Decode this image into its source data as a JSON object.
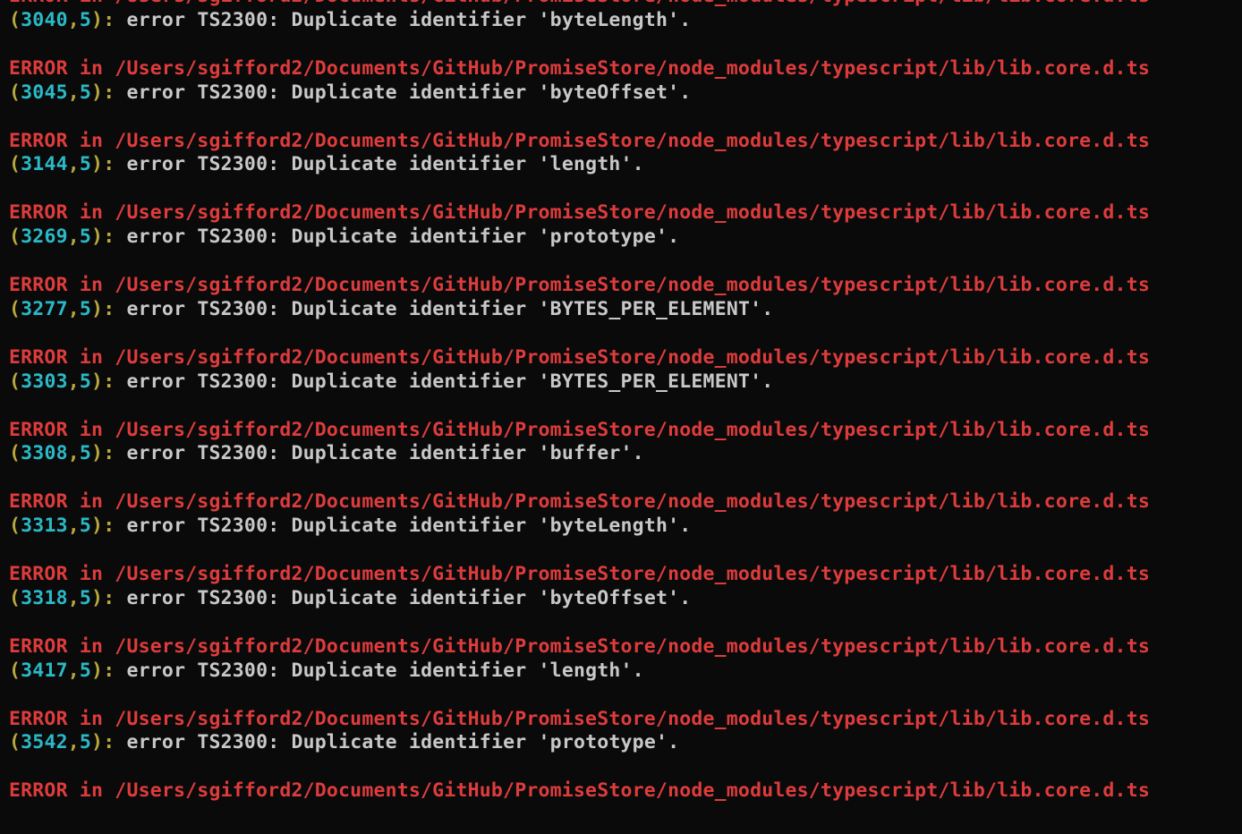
{
  "filepath": "/Users/sgifford2/Documents/GitHub/PromiseStore/node_modules/typescript/lib/lib.core.d.ts",
  "errorPrefix": "ERROR in ",
  "errors": [
    {
      "line": "3040",
      "col": "5",
      "code": "TS2300",
      "identifier": "byteLength"
    },
    {
      "line": "3045",
      "col": "5",
      "code": "TS2300",
      "identifier": "byteOffset"
    },
    {
      "line": "3144",
      "col": "5",
      "code": "TS2300",
      "identifier": "length"
    },
    {
      "line": "3269",
      "col": "5",
      "code": "TS2300",
      "identifier": "prototype"
    },
    {
      "line": "3277",
      "col": "5",
      "code": "TS2300",
      "identifier": "BYTES_PER_ELEMENT"
    },
    {
      "line": "3303",
      "col": "5",
      "code": "TS2300",
      "identifier": "BYTES_PER_ELEMENT"
    },
    {
      "line": "3308",
      "col": "5",
      "code": "TS2300",
      "identifier": "buffer"
    },
    {
      "line": "3313",
      "col": "5",
      "code": "TS2300",
      "identifier": "byteLength"
    },
    {
      "line": "3318",
      "col": "5",
      "code": "TS2300",
      "identifier": "byteOffset"
    },
    {
      "line": "3417",
      "col": "5",
      "code": "TS2300",
      "identifier": "length"
    },
    {
      "line": "3542",
      "col": "5",
      "code": "TS2300",
      "identifier": "prototype"
    }
  ],
  "partialLastLineOnly": true,
  "messageTemplate": {
    "errorWord": "error ",
    "msgPrefix": ": Duplicate identifier '",
    "msgSuffix": "'."
  }
}
